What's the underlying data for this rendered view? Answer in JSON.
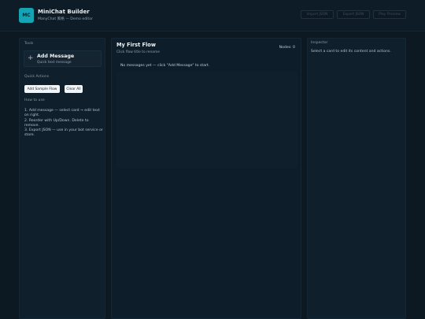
{
  "header": {
    "logo_text": "MC",
    "title": "MiniChat Builder",
    "subtitle": "ManyChat 風格 — Demo editor",
    "buttons": {
      "import": "Import JSON",
      "export": "Export JSON",
      "play": "Play Preview"
    }
  },
  "tools": {
    "label": "Tools",
    "add_message": {
      "title": "Add Message",
      "subtitle": "Quick text message",
      "icon": "plus-icon"
    }
  },
  "quick_actions": {
    "label": "Quick Actions",
    "add_sample": "Add Sample Flow",
    "clear_all": "Clear All"
  },
  "how_to": {
    "label": "How to use",
    "steps": [
      "1. Add message — select card → edit text on right.",
      "2. Reorder with Up/Down. Delete to remove.",
      "3. Export JSON — use in your bot service or store."
    ]
  },
  "flow": {
    "title": "My First Flow",
    "hint": "Click flow title to rename",
    "nodes": "Nodes: 0",
    "empty": "No messages yet — click \"Add Message\" to start."
  },
  "inspector": {
    "title": "Inspector",
    "hint": "Select a card to edit its content and actions."
  }
}
